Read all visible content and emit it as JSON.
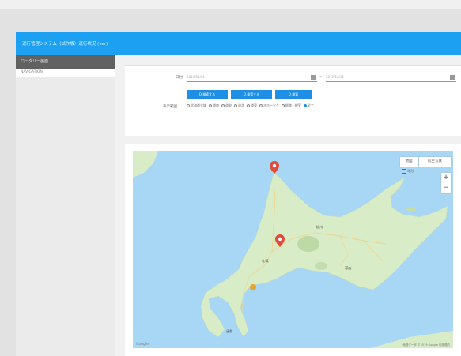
{
  "header": {
    "title": "運行管理システム（試作版）運行状況 (ver)"
  },
  "sidebar": {
    "heading": "ロータリー画面",
    "items": [
      {
        "label": "NAVIGATION"
      }
    ]
  },
  "filter": {
    "date_label": "日付",
    "date_from": {
      "placeholder": "2019/01/01"
    },
    "separator": "〜",
    "date_to": {
      "placeholder": "2019/12/31"
    },
    "buttons": [
      {
        "label": "Q 検索する"
      },
      {
        "label": "Q 検索する"
      },
      {
        "label": "Q 検索"
      }
    ],
    "area_label": "表示範囲",
    "radios": [
      {
        "label": "北海道全域",
        "selected": false
      },
      {
        "label": "道南",
        "selected": false
      },
      {
        "label": "道央",
        "selected": false
      },
      {
        "label": "道北",
        "selected": false
      },
      {
        "label": "道東",
        "selected": false
      },
      {
        "label": "オホーツク",
        "selected": false
      },
      {
        "label": "釧路・根室",
        "selected": false
      },
      {
        "label": "全て",
        "selected": true
      }
    ]
  },
  "map": {
    "type_map": "地図",
    "type_satellite": "航空写真",
    "terrain_label": "地形",
    "zoom_in": "+",
    "zoom_out": "−",
    "logo": "Google",
    "attribution": "地図データ ©2019 Google  利用規約",
    "cities": [
      "札幌",
      "旭川",
      "帯広",
      "函館"
    ]
  },
  "colors": {
    "header": "#1ca1f2",
    "button": "#1f8fe6",
    "marker": "#e14b3b",
    "land": "#d8ecc8",
    "sea": "#a8d7f5"
  }
}
